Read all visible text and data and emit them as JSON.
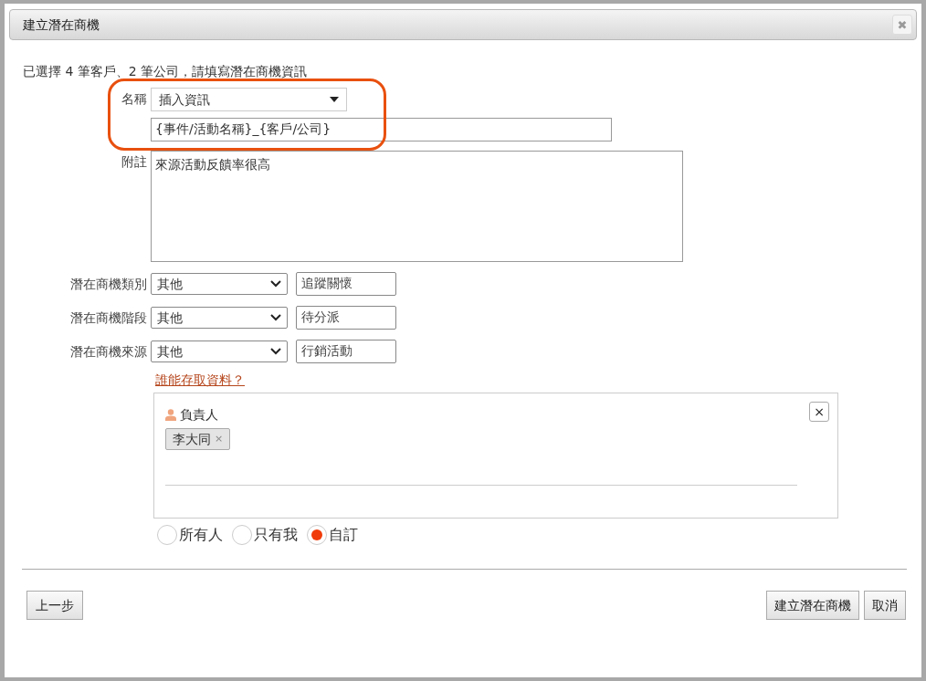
{
  "window": {
    "title": "建立潛在商機",
    "close": "✖"
  },
  "intro": "已選擇 4 筆客戶、2 筆公司，請填寫潛在商機資訊",
  "name": {
    "label": "名稱",
    "insert_select": "插入資訊",
    "value": "{事件/活動名稱}_{客戶/公司}"
  },
  "note": {
    "label": "附註",
    "value": "來源活動反饋率很高"
  },
  "fields": [
    {
      "label": "潛在商機類別",
      "select": "其他",
      "value": "追蹤關懷"
    },
    {
      "label": "潛在商機階段",
      "select": "其他",
      "value": "待分派"
    },
    {
      "label": "潛在商機來源",
      "select": "其他",
      "value": "行銷活動"
    }
  ],
  "access_link": "誰能存取資料？",
  "access_panel": {
    "close": "×",
    "role": "負責人",
    "tags": [
      {
        "label": "李大同",
        "remove": "×"
      }
    ]
  },
  "visibility": [
    {
      "label": "所有人",
      "selected": false
    },
    {
      "label": "只有我",
      "selected": false
    },
    {
      "label": "自訂",
      "selected": true
    }
  ],
  "buttons": {
    "back": "上一步",
    "create": "建立潛在商機",
    "cancel": "取消"
  }
}
